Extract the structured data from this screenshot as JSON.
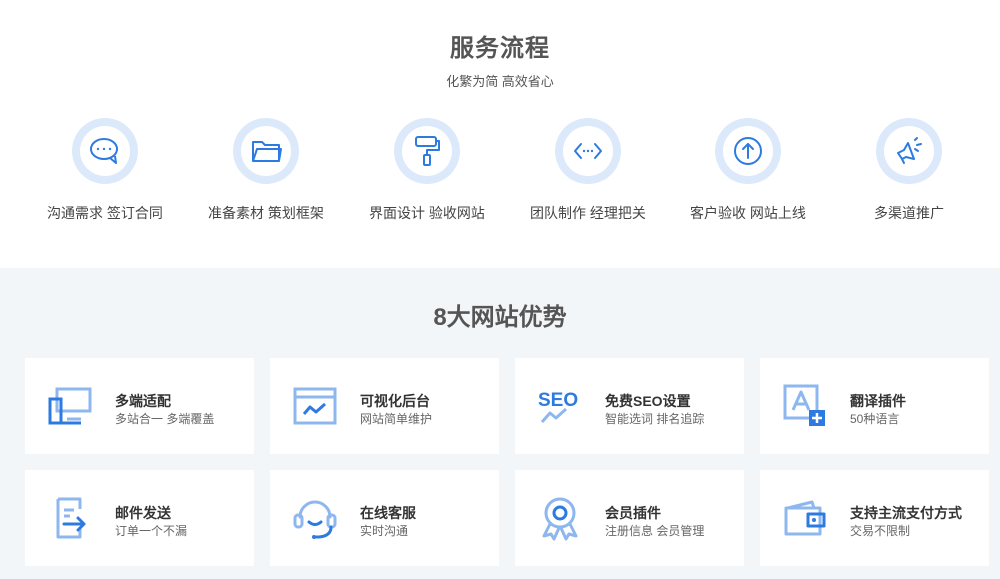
{
  "process": {
    "title": "服务流程",
    "subtitle": "化繁为简 高效省心",
    "steps": [
      {
        "label": "沟通需求 签订合同",
        "icon": "chat-bubble-icon"
      },
      {
        "label": "准备素材 策划框架",
        "icon": "folder-icon"
      },
      {
        "label": "界面设计 验收网站",
        "icon": "paint-roller-icon"
      },
      {
        "label": "团队制作 经理把关",
        "icon": "code-icon"
      },
      {
        "label": "客户验收 网站上线",
        "icon": "upload-icon"
      },
      {
        "label": "多渠道推广",
        "icon": "megaphone-icon"
      }
    ]
  },
  "advantages": {
    "title": "8大网站优势",
    "items": [
      {
        "title": "多端适配",
        "desc": "多站合一 多端覆盖",
        "icon": "devices-icon"
      },
      {
        "title": "可视化后台",
        "desc": "网站简单维护",
        "icon": "dashboard-icon"
      },
      {
        "title": "免费SEO设置",
        "desc": "智能选词 排名追踪",
        "icon": "seo-icon",
        "icon_text": "SEO"
      },
      {
        "title": "翻译插件",
        "desc": "50种语言",
        "icon": "translate-icon"
      },
      {
        "title": "邮件发送",
        "desc": "订单一个不漏",
        "icon": "mail-send-icon"
      },
      {
        "title": "在线客服",
        "desc": "实时沟通",
        "icon": "headset-icon"
      },
      {
        "title": "会员插件",
        "desc": "注册信息 会员管理",
        "icon": "member-badge-icon"
      },
      {
        "title": "支持主流支付方式",
        "desc": "交易不限制",
        "icon": "wallet-icon"
      }
    ]
  },
  "colors": {
    "accent": "#2d7be0",
    "accent_light": "#8db7ee",
    "circle_bg": "#dce9fb",
    "section_bg": "#f3f6f8"
  }
}
